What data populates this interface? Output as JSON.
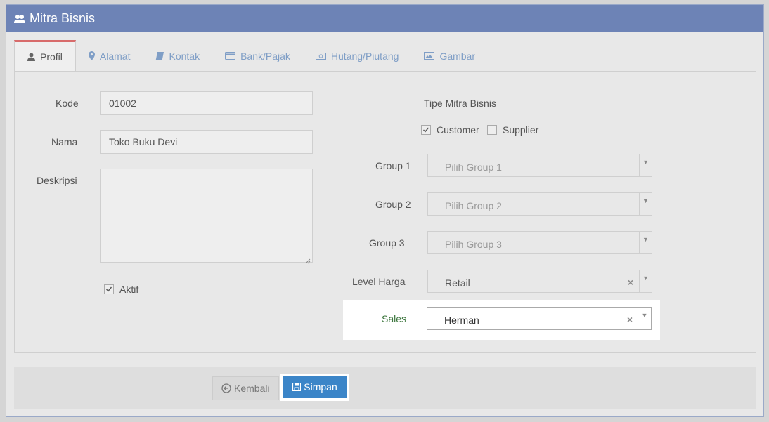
{
  "header": {
    "title": "Mitra Bisnis",
    "icon": "users-icon"
  },
  "tabs": [
    {
      "label": "Profil",
      "icon": "user-icon",
      "active": true
    },
    {
      "label": "Alamat",
      "icon": "map-marker-icon"
    },
    {
      "label": "Kontak",
      "icon": "book-icon"
    },
    {
      "label": "Bank/Pajak",
      "icon": "credit-card-icon"
    },
    {
      "label": "Hutang/Piutang",
      "icon": "money-icon"
    },
    {
      "label": "Gambar",
      "icon": "image-icon"
    }
  ],
  "form": {
    "kode": {
      "label": "Kode",
      "value": "01002"
    },
    "nama": {
      "label": "Nama",
      "value": "Toko Buku Devi"
    },
    "deskripsi": {
      "label": "Deskripsi",
      "value": ""
    },
    "aktif": {
      "label": "Aktif",
      "checked": true
    },
    "tipe": {
      "label": "Tipe Mitra Bisnis",
      "customer": {
        "label": "Customer",
        "checked": true
      },
      "supplier": {
        "label": "Supplier",
        "checked": false
      }
    },
    "group1": {
      "label": "Group 1",
      "placeholder": "Pilih Group 1"
    },
    "group2": {
      "label": "Group 2",
      "placeholder": "Pilih Group 2"
    },
    "group3": {
      "label": "Group 3",
      "placeholder": "Pilih Group 3"
    },
    "level_harga": {
      "label": "Level Harga",
      "value": "Retail"
    },
    "sales": {
      "label": "Sales",
      "value": "Herman"
    }
  },
  "footer": {
    "back_label": "Kembali",
    "save_label": "Simpan"
  },
  "colors": {
    "header": "#6d83b6",
    "save_button": "#3b85c8",
    "active_tab_border": "#d86b6b"
  }
}
